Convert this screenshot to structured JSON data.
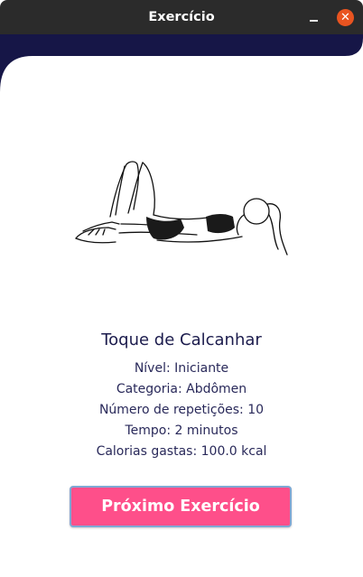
{
  "window": {
    "title": "Exercício",
    "minimize_icon": "minimize-icon",
    "close_icon": "close-icon",
    "close_glyph": "✕",
    "close_color": "#e95420"
  },
  "theme": {
    "header_color": "#161647",
    "button_color": "#fe4f8a",
    "text_color": "#1c1c4d"
  },
  "exercise": {
    "illustration_icon": "heel-touch-exercise-illustration",
    "name": "Toque de Calcanhar",
    "level": "Nível: Iniciante",
    "category": "Categoria: Abdômen",
    "repetitions": "Número de repetições: 10",
    "time": "Tempo: 2 minutos",
    "calories": "Calorias gastas: 100.0 kcal"
  },
  "actions": {
    "next_label": "Próximo Exercício"
  }
}
